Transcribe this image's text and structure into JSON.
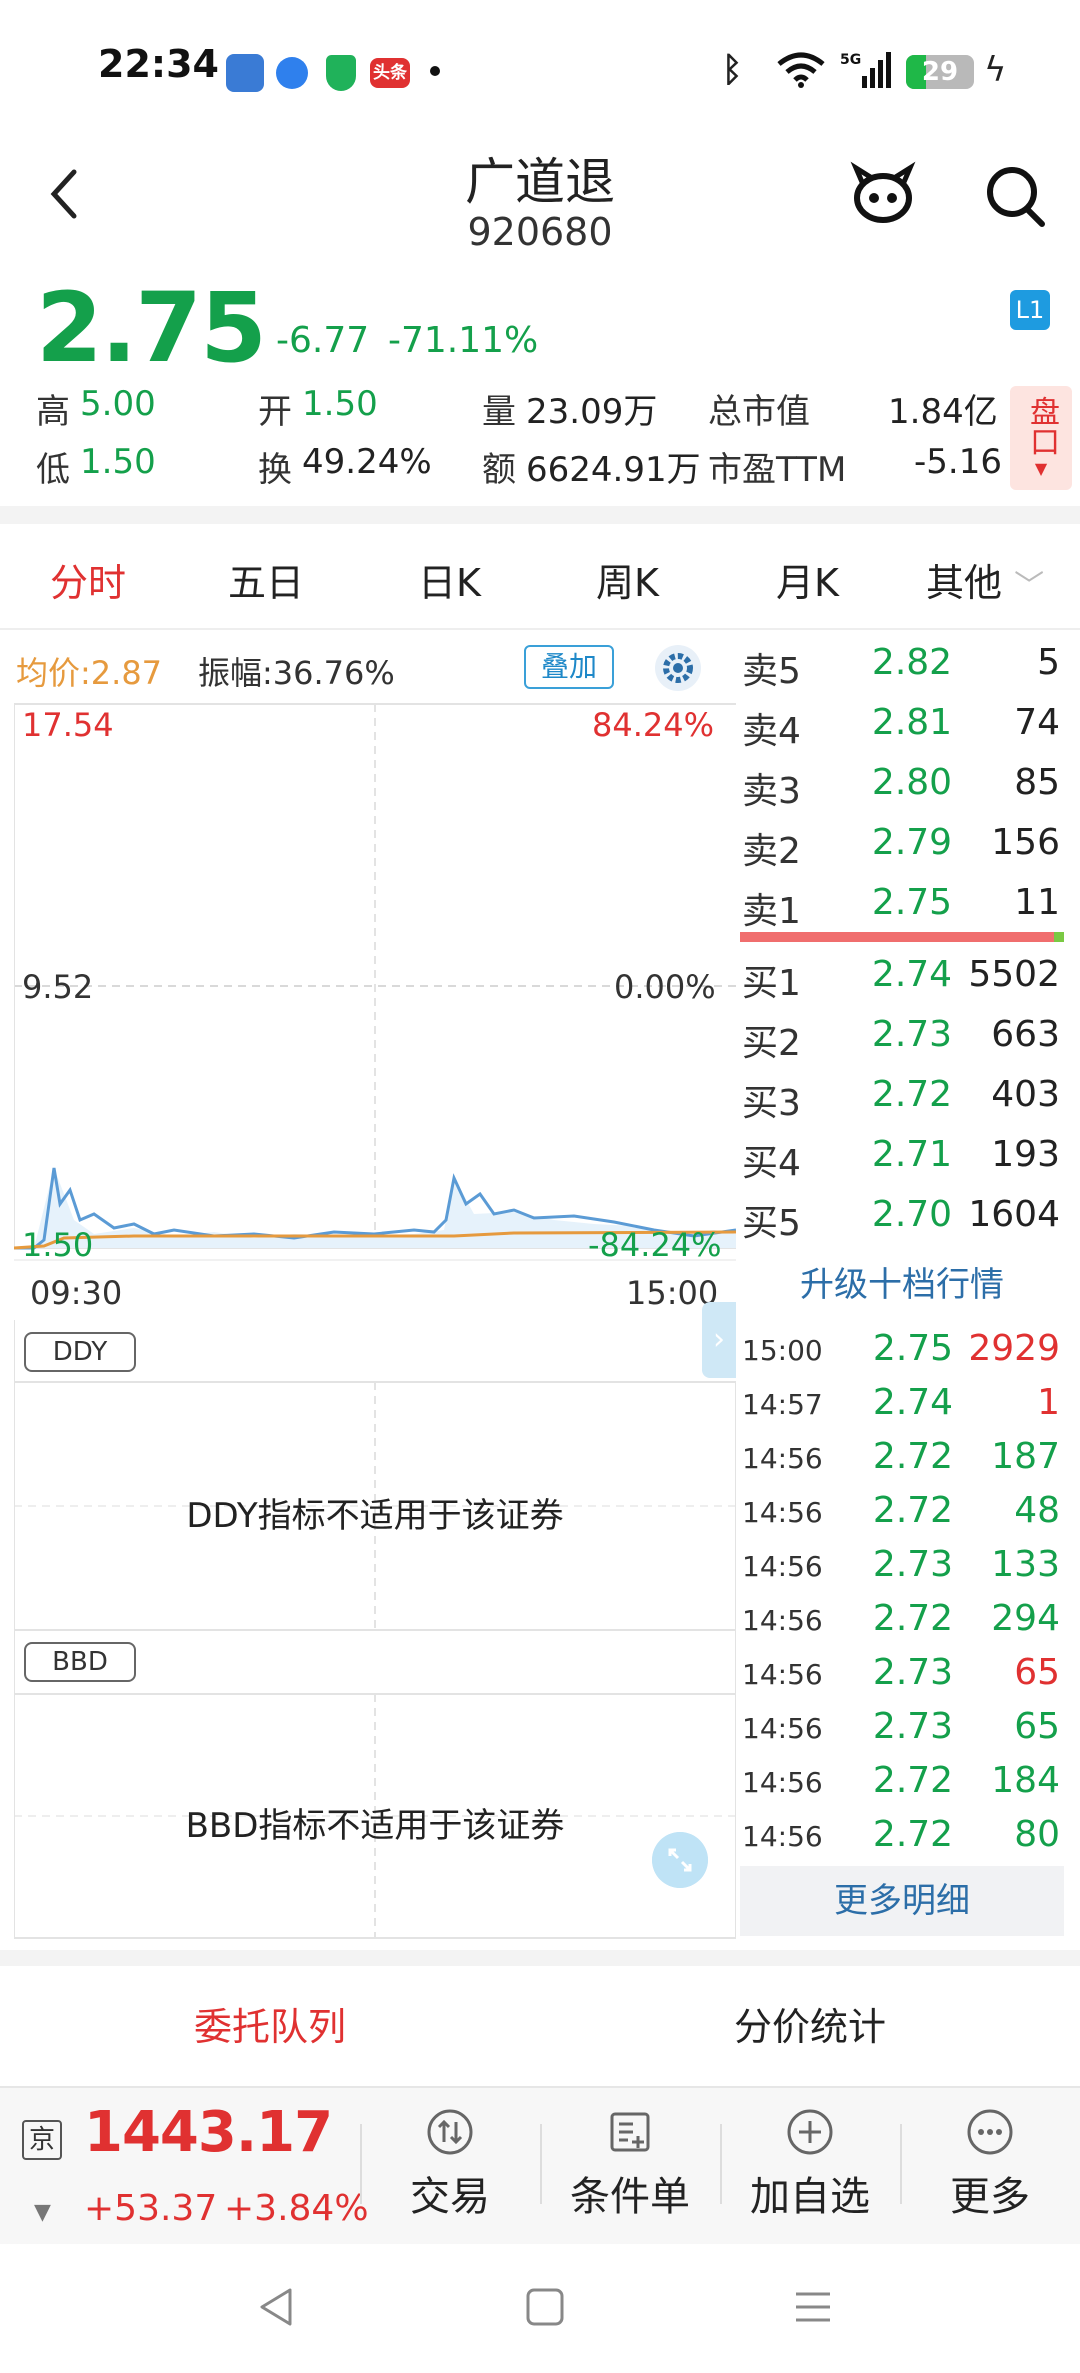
{
  "status_bar": {
    "time": "22:34",
    "notif_badge": "头条",
    "battery": "29",
    "signal": "5G"
  },
  "header": {
    "name": "广道退",
    "code": "920680",
    "level_badge": "L1"
  },
  "quote": {
    "price": "2.75",
    "change": "-6.77",
    "change_pct": "-71.11%",
    "stats": [
      {
        "label": "高",
        "value": "5.00",
        "color": "green"
      },
      {
        "label": "开",
        "value": "1.50",
        "color": "green"
      },
      {
        "label": "量",
        "value": "23.09万",
        "color": "dark"
      },
      {
        "label": "总市值",
        "value": "1.84亿",
        "color": "dark"
      },
      {
        "label": "低",
        "value": "1.50",
        "color": "green"
      },
      {
        "label": "换",
        "value": "49.24%",
        "color": "dark"
      },
      {
        "label": "额",
        "value": "6624.91万",
        "color": "dark"
      },
      {
        "label": "市盈TTM",
        "value": "-5.16",
        "color": "dark"
      }
    ],
    "pankou_label": "盘口"
  },
  "tabs": [
    "分时",
    "五日",
    "日K",
    "周K",
    "月K",
    "其他"
  ],
  "chart": {
    "avg_label": "均价:2.87",
    "amplitude_label": "振幅:36.76%",
    "overlay_label": "叠加",
    "y_top": "17.54",
    "y_mid": "9.52",
    "y_bottom": "1.50",
    "pct_top": "84.24%",
    "pct_mid": "0.00%",
    "pct_bottom": "-84.24%",
    "x_start": "09:30",
    "x_end": "15:00",
    "ddy_tag": "DDY",
    "ddy_message": "DDY指标不适用于该证券",
    "bbd_tag": "BBD",
    "bbd_message": "BBD指标不适用于该证券",
    "colors": {
      "price_line": "#5b9bd5",
      "avg_line": "#e69a3e",
      "fill": "#e6f2fb"
    }
  },
  "order_book": {
    "asks": [
      {
        "label": "卖5",
        "price": "2.82",
        "vol": "5"
      },
      {
        "label": "卖4",
        "price": "2.81",
        "vol": "74"
      },
      {
        "label": "卖3",
        "price": "2.80",
        "vol": "85"
      },
      {
        "label": "卖2",
        "price": "2.79",
        "vol": "156"
      },
      {
        "label": "卖1",
        "price": "2.75",
        "vol": "11"
      }
    ],
    "bids": [
      {
        "label": "买1",
        "price": "2.74",
        "vol": "5502"
      },
      {
        "label": "买2",
        "price": "2.73",
        "vol": "663"
      },
      {
        "label": "买3",
        "price": "2.72",
        "vol": "403"
      },
      {
        "label": "买4",
        "price": "2.71",
        "vol": "193"
      },
      {
        "label": "买5",
        "price": "2.70",
        "vol": "1604"
      }
    ],
    "upgrade_label": "升级十档行情"
  },
  "trades": [
    {
      "time": "15:00",
      "price": "2.75",
      "vol": "2929",
      "dir": "red"
    },
    {
      "time": "14:57",
      "price": "2.74",
      "vol": "1",
      "dir": "red"
    },
    {
      "time": "14:56",
      "price": "2.72",
      "vol": "187",
      "dir": "green"
    },
    {
      "time": "14:56",
      "price": "2.72",
      "vol": "48",
      "dir": "green"
    },
    {
      "time": "14:56",
      "price": "2.73",
      "vol": "133",
      "dir": "green"
    },
    {
      "time": "14:56",
      "price": "2.72",
      "vol": "294",
      "dir": "green"
    },
    {
      "time": "14:56",
      "price": "2.73",
      "vol": "65",
      "dir": "red"
    },
    {
      "time": "14:56",
      "price": "2.73",
      "vol": "65",
      "dir": "green"
    },
    {
      "time": "14:56",
      "price": "2.72",
      "vol": "184",
      "dir": "green"
    },
    {
      "time": "14:56",
      "price": "2.72",
      "vol": "80",
      "dir": "green"
    }
  ],
  "more_detail_label": "更多明细",
  "bottom_tabs": {
    "queue": "委托队列",
    "stats": "分价统计"
  },
  "index_bar": {
    "market_tag": "京",
    "value": "1443.17",
    "change": "+53.37",
    "change_pct": "+3.84%"
  },
  "actions": [
    {
      "label": "交易",
      "icon": "trade-icon"
    },
    {
      "label": "条件单",
      "icon": "conditional-order-icon"
    },
    {
      "label": "加自选",
      "icon": "add-watchlist-icon"
    },
    {
      "label": "更多",
      "icon": "more-icon"
    }
  ]
}
